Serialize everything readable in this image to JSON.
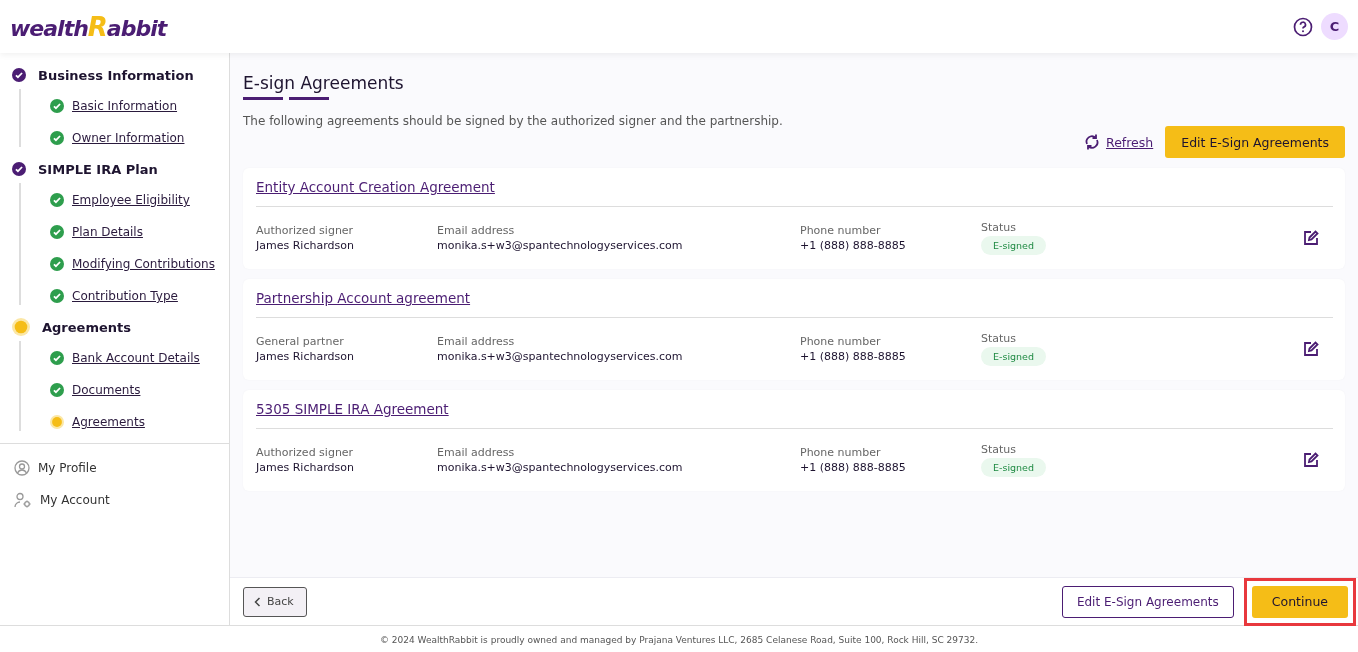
{
  "header": {
    "logo": {
      "prefix": "wealth",
      "accent": "R",
      "suffix": "abbit"
    },
    "avatar": "C"
  },
  "sidebar": {
    "sections": [
      {
        "label": "Business Information",
        "completed": true,
        "children": [
          {
            "label": "Basic Information",
            "completed": true
          },
          {
            "label": "Owner Information",
            "completed": true
          }
        ]
      },
      {
        "label": "SIMPLE IRA Plan",
        "completed": true,
        "children": [
          {
            "label": "Employee Eligibility",
            "completed": true
          },
          {
            "label": "Plan Details",
            "completed": true
          },
          {
            "label": "Modifying Contributions",
            "completed": true
          },
          {
            "label": "Contribution Type",
            "completed": true
          }
        ]
      },
      {
        "label": "Agreements",
        "completed": false,
        "children": [
          {
            "label": "Bank Account Details",
            "completed": true
          },
          {
            "label": "Documents",
            "completed": true
          },
          {
            "label": "Agreements",
            "completed": false
          }
        ]
      }
    ],
    "menu": [
      {
        "label": "My Profile",
        "kind": "profile"
      },
      {
        "label": "My Account",
        "kind": "account"
      }
    ]
  },
  "main": {
    "title": "E-sign Agreements",
    "description": "The following agreements should be signed by the authorized signer and the partnership.",
    "refresh": "Refresh",
    "edit_button": "Edit E-Sign Agreements",
    "agreements": [
      {
        "title": "Entity Account Creation Agreement",
        "role_label": "Authorized signer",
        "name": "James Richardson",
        "email_label": "Email address",
        "email": "monika.s+w3@spantechnologyservices.com",
        "phone_label": "Phone number",
        "phone": "+1 (888) 888-8885",
        "status_label": "Status",
        "status": "E-signed"
      },
      {
        "title": "Partnership Account agreement",
        "role_label": "General partner",
        "name": "James Richardson",
        "email_label": "Email address",
        "email": "monika.s+w3@spantechnologyservices.com",
        "phone_label": "Phone number",
        "phone": "+1 (888) 888-8885",
        "status_label": "Status",
        "status": "E-signed"
      },
      {
        "title": "5305 SIMPLE IRA Agreement",
        "role_label": "Authorized signer",
        "name": "James Richardson",
        "email_label": "Email address",
        "email": "monika.s+w3@spantechnologyservices.com",
        "phone_label": "Phone number",
        "phone": "+1 (888) 888-8885",
        "status_label": "Status",
        "status": "E-signed"
      }
    ]
  },
  "actions": {
    "back": "Back",
    "edit": "Edit E-Sign Agreements",
    "continue": {
      "label": "Continue",
      "highlighted": true
    }
  },
  "footer": "© 2024 WealthRabbit is proudly owned and managed by Prajana Ventures LLC, 2685 Celanese Road, Suite 100, Rock Hill, SC 29732."
}
